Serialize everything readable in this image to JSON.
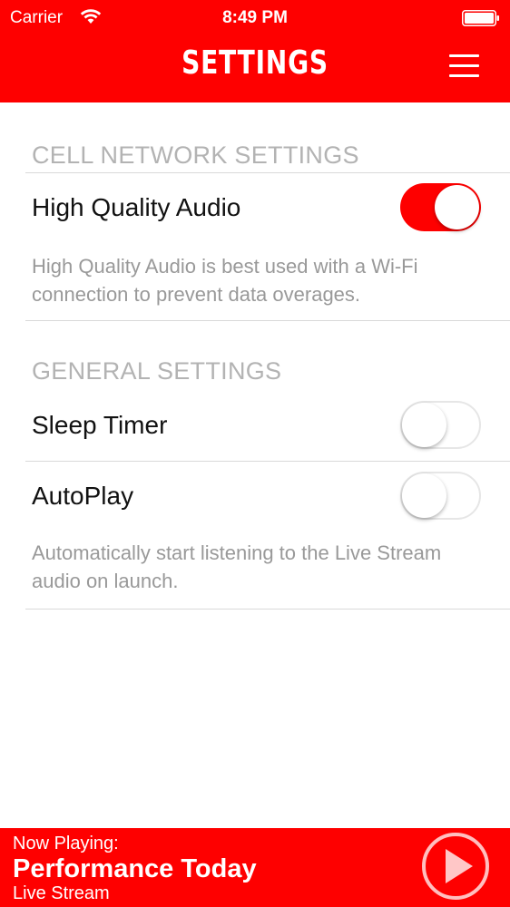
{
  "status_bar": {
    "carrier": "Carrier",
    "time": "8:49 PM"
  },
  "header": {
    "title": "SETTINGS",
    "menu_icon": "hamburger-menu-icon",
    "background_color": "#fe0000"
  },
  "sections": [
    {
      "header": "CELL NETWORK SETTINGS",
      "rows": [
        {
          "label": "High Quality Audio",
          "enabled": true,
          "description": "High Quality Audio is best used with a Wi-Fi connection to prevent data overages."
        }
      ]
    },
    {
      "header": "GENERAL SETTINGS",
      "rows": [
        {
          "label": "Sleep Timer",
          "enabled": false
        },
        {
          "label": "AutoPlay",
          "enabled": false,
          "description": "Automatically start listening to the Live Stream audio on launch."
        }
      ]
    }
  ],
  "now_playing": {
    "label": "Now Playing:",
    "title": "Performance Today",
    "subtitle": "Live Stream",
    "play_icon": "play-icon"
  }
}
